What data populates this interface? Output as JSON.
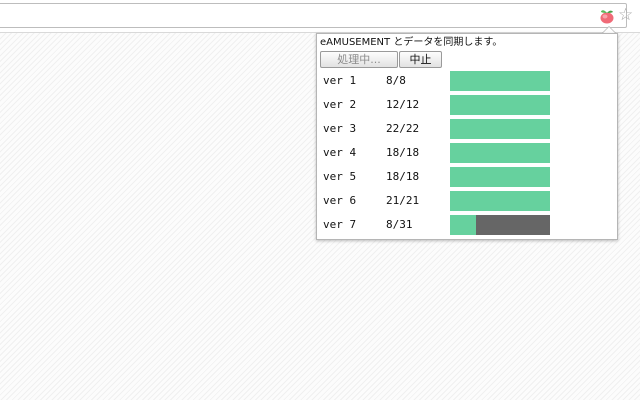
{
  "toolbar": {
    "extension_icon": "peach-extension-icon",
    "star_icon": "bookmark-star-icon",
    "star_glyph": "☆"
  },
  "popup": {
    "title": "eAMUSEMENT とデータを同期します。",
    "processing_button": "処理中...",
    "stop_button": "中止",
    "rows": [
      {
        "label": "ver 1",
        "count": "8/8",
        "done": 8,
        "total": 8
      },
      {
        "label": "ver 2",
        "count": "12/12",
        "done": 12,
        "total": 12
      },
      {
        "label": "ver 3",
        "count": "22/22",
        "done": 22,
        "total": 22
      },
      {
        "label": "ver 4",
        "count": "18/18",
        "done": 18,
        "total": 18
      },
      {
        "label": "ver 5",
        "count": "18/18",
        "done": 18,
        "total": 18
      },
      {
        "label": "ver 6",
        "count": "21/21",
        "done": 21,
        "total": 21
      },
      {
        "label": "ver 7",
        "count": "8/31",
        "done": 8,
        "total": 31
      }
    ]
  },
  "colors": {
    "progress_fill": "#66d19e",
    "progress_track": "#666666"
  }
}
